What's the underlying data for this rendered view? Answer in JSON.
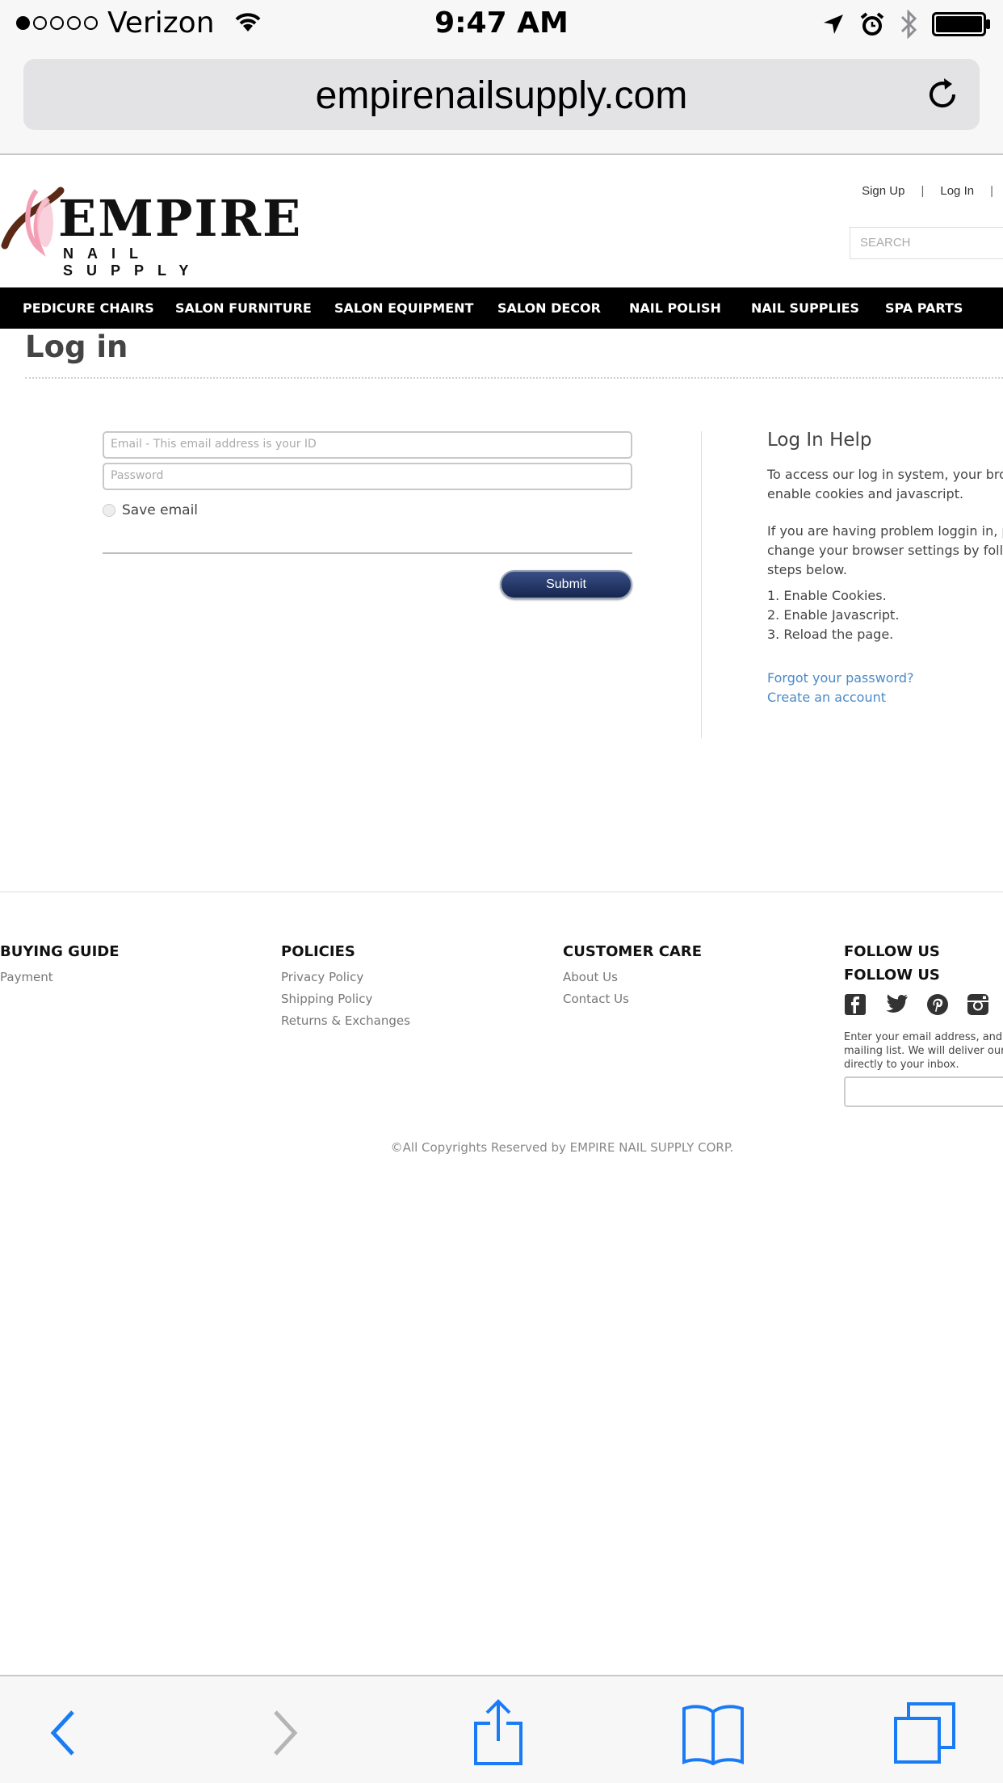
{
  "status_bar": {
    "carrier": "Verizon",
    "time": "9:47 AM",
    "signal_bars_filled": 1,
    "signal_bars_total": 5,
    "icons": [
      "wifi-icon",
      "location-arrow-icon",
      "alarm-clock-icon",
      "bluetooth-icon",
      "battery-icon"
    ]
  },
  "browser": {
    "url": "empirenailsupply.com"
  },
  "header": {
    "logo_word": "EMPIRE",
    "logo_sub": "NAIL SUPPLY",
    "sign_up": "Sign Up",
    "separator": "|",
    "log_in": "Log In",
    "search_placeholder": "SEARCH"
  },
  "nav": {
    "items": [
      "PEDICURE CHAIRS",
      "SALON FURNITURE",
      "SALON EQUIPMENT",
      "SALON DECOR",
      "NAIL POLISH",
      "NAIL SUPPLIES",
      "SPA PARTS"
    ]
  },
  "login": {
    "title": "Log in",
    "email_placeholder": "Email - This email address is your ID",
    "password_placeholder": "Password",
    "save_email": "Save email",
    "submit": "Submit"
  },
  "help": {
    "title": "Log In Help",
    "p1_line1": "To access our log in system, your brow",
    "p1_line2": "enable cookies and javascript.",
    "p2_line1": "If you are having problem loggin in, ple",
    "p2_line2": "change your browser settings by follow",
    "p2_line3": "steps below.",
    "steps": [
      "1. Enable Cookies.",
      "2. Enable Javascript.",
      "3. Reload the page."
    ],
    "forgot": "Forgot your password?",
    "create": "Create an account"
  },
  "footer": {
    "buying_guide": {
      "heading": "BUYING GUIDE",
      "links": [
        "Payment"
      ]
    },
    "policies": {
      "heading": "POLICIES",
      "links": [
        "Privacy Policy",
        "Shipping Policy",
        "Returns & Exchanges"
      ]
    },
    "customer_care": {
      "heading": "CUSTOMER CARE",
      "links": [
        "About Us",
        "Contact Us"
      ]
    },
    "follow": {
      "heading": "FOLLOW US",
      "heading2": "FOLLOW US",
      "social": [
        "facebook-icon",
        "twitter-icon",
        "pinterest-icon",
        "instagram-icon"
      ],
      "note_line1": "Enter your email address, and",
      "note_line2": "mailing list. We will deliver our",
      "note_line3": "directly to your inbox."
    },
    "copyright": "©All Copyrights Reserved by EMPIRE NAIL SUPPLY CORP."
  },
  "colors": {
    "nav_bg": "#000000",
    "link_blue": "#4b8ac9",
    "ios_blue": "#1a7cf5",
    "button_navy": "#1d2d5c"
  }
}
